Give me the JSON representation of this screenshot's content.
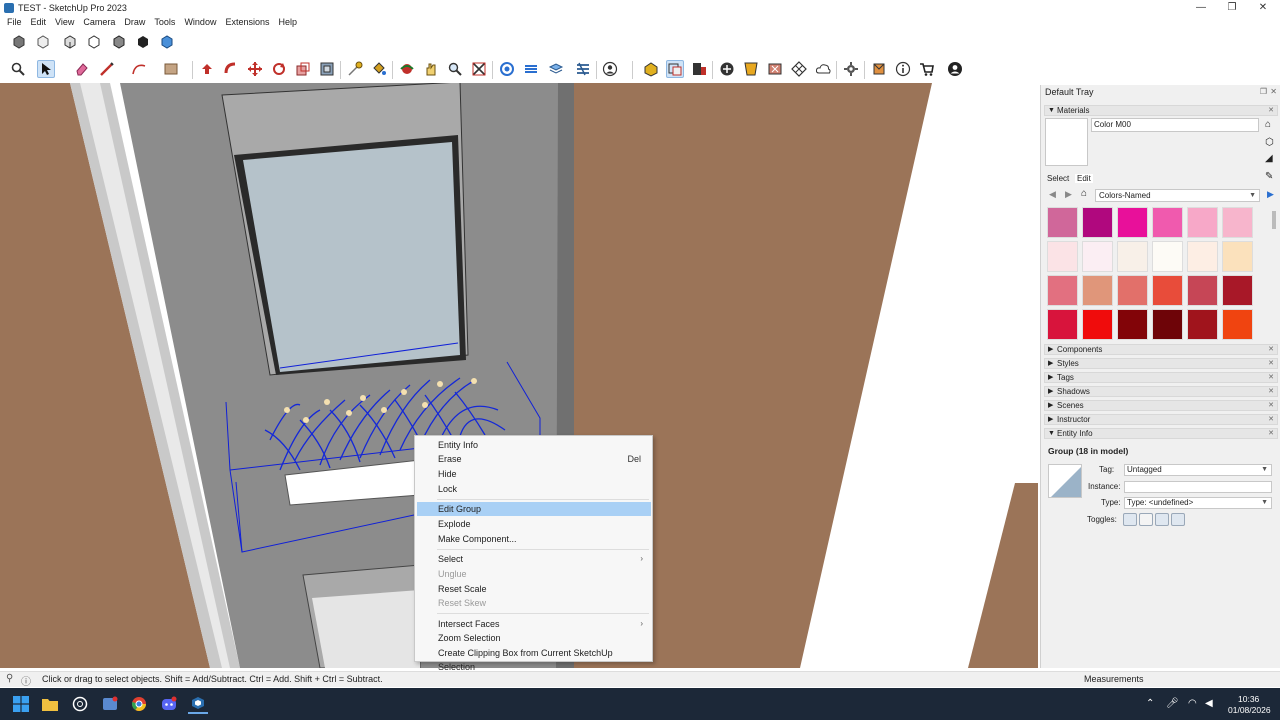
{
  "window": {
    "title": "TEST - SketchUp Pro 2023",
    "minimize": "—",
    "maximize": "❐",
    "close": "✕"
  },
  "menubar": [
    "File",
    "Edit",
    "View",
    "Camera",
    "Draw",
    "Tools",
    "Window",
    "Extensions",
    "Help"
  ],
  "context_menu": {
    "items": [
      {
        "label": "Entity Info",
        "shortcut": "",
        "disabled": false,
        "highlighted": false,
        "submenu": false
      },
      {
        "label": "Erase",
        "shortcut": "Del",
        "disabled": false,
        "highlighted": false,
        "submenu": false
      },
      {
        "label": "Hide",
        "shortcut": "",
        "disabled": false,
        "highlighted": false,
        "submenu": false
      },
      {
        "label": "Lock",
        "shortcut": "",
        "disabled": false,
        "highlighted": false,
        "submenu": false
      },
      {
        "label": "Edit Group",
        "shortcut": "",
        "disabled": false,
        "highlighted": true,
        "submenu": false
      },
      {
        "label": "Explode",
        "shortcut": "",
        "disabled": false,
        "highlighted": false,
        "submenu": false
      },
      {
        "label": "Make Component...",
        "shortcut": "",
        "disabled": false,
        "highlighted": false,
        "submenu": false
      },
      {
        "label": "Select",
        "shortcut": "",
        "disabled": false,
        "highlighted": false,
        "submenu": true
      },
      {
        "label": "Unglue",
        "shortcut": "",
        "disabled": true,
        "highlighted": false,
        "submenu": false
      },
      {
        "label": "Reset Scale",
        "shortcut": "",
        "disabled": false,
        "highlighted": false,
        "submenu": false
      },
      {
        "label": "Reset Skew",
        "shortcut": "",
        "disabled": true,
        "highlighted": false,
        "submenu": false
      },
      {
        "label": "Intersect Faces",
        "shortcut": "",
        "disabled": false,
        "highlighted": false,
        "submenu": true
      },
      {
        "label": "Zoom Selection",
        "shortcut": "",
        "disabled": false,
        "highlighted": false,
        "submenu": false
      },
      {
        "label": "Create Clipping Box from Current SketchUp Selection",
        "shortcut": "",
        "disabled": false,
        "highlighted": false,
        "submenu": false
      }
    ]
  },
  "tray": {
    "title": "Default Tray",
    "materials": {
      "header": "Materials",
      "material_name": "Color M00",
      "tab_select": "Select",
      "tab_edit": "Edit",
      "collection": "Colors-Named",
      "swatch_colors": [
        "#d0679a",
        "#b0087e",
        "#e8109a",
        "#f05aae",
        "#f7a8c8",
        "#f7b5cc",
        "#fbe3e6",
        "#fbeef3",
        "#f8f0e8",
        "#fdfbf6",
        "#fdeee4",
        "#fbe1bc",
        "#e27080",
        "#e0967a",
        "#e2706a",
        "#e84c3a",
        "#c64656",
        "#a81828",
        "#d8143c",
        "#f00c0c",
        "#820408",
        "#6e0408",
        "#a0141c",
        "#f04410"
      ]
    },
    "collapsed_panels": [
      "Components",
      "Styles",
      "Tags",
      "Shadows",
      "Scenes",
      "Instructor"
    ],
    "entity_info": {
      "header": "Entity Info",
      "title": "Group (18 in model)",
      "tag_label": "Tag:",
      "tag_value": "Untagged",
      "instance_label": "Instance:",
      "instance_value": "",
      "type_label": "Type:",
      "type_value": "Type: <undefined>",
      "toggles_label": "Toggles:"
    }
  },
  "statusbar": {
    "hint": "Click or drag to select objects. Shift = Add/Subtract. Ctrl = Add. Shift + Ctrl = Subtract.",
    "measurements_label": "Measurements"
  },
  "taskbar": {
    "time": "10:36",
    "date": "01/08/2026"
  },
  "colors": {
    "wall_brown": "#9b7458",
    "wall_gray": "#a8a8a8",
    "selection_blue": "#1020d8",
    "menu_highlight": "#a9d0f5"
  }
}
